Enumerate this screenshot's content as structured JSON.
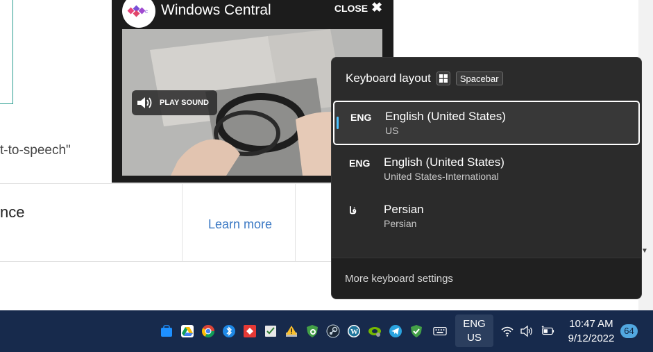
{
  "webpage": {
    "snippet_text": "t-to-speech\"",
    "card_title": "nce",
    "learn_more_label": "Learn more"
  },
  "video_popup": {
    "title": "Windows Central",
    "close_label": "CLOSE",
    "play_sound_label": "PLAY SOUND"
  },
  "keyboard_flyout": {
    "title": "Keyboard layout",
    "shortcut_key": "Spacebar",
    "layouts": [
      {
        "code": "ENG",
        "name": "English (United States)",
        "sub": "US",
        "selected": true
      },
      {
        "code": "ENG",
        "name": "English (United States)",
        "sub": "United States-International",
        "selected": false
      },
      {
        "code": "فا",
        "name": "Persian",
        "sub": "Persian",
        "selected": false
      }
    ],
    "more_settings_label": "More keyboard settings"
  },
  "taskbar": {
    "language": {
      "line1": "ENG",
      "line2": "US"
    },
    "clock": {
      "time": "10:47 AM",
      "date": "9/12/2022"
    },
    "notification_count": "64",
    "tray_icons": [
      "windows-store-icon",
      "google-drive-icon",
      "chrome-icon",
      "bluetooth-icon",
      "anydesk-icon",
      "tasks-icon",
      "warning-icon",
      "security-shield-icon",
      "steam-icon",
      "wordpress-icon",
      "nvidia-icon",
      "telegram-icon",
      "checkmark-app-icon",
      "touch-keyboard-icon",
      "wifi-icon",
      "volume-icon",
      "battery-icon"
    ]
  },
  "colors": {
    "accent": "#4cc2ff",
    "taskbar_bg": "#172a4c",
    "flyout_bg": "#2b2b2b",
    "link": "#3b79c4"
  }
}
